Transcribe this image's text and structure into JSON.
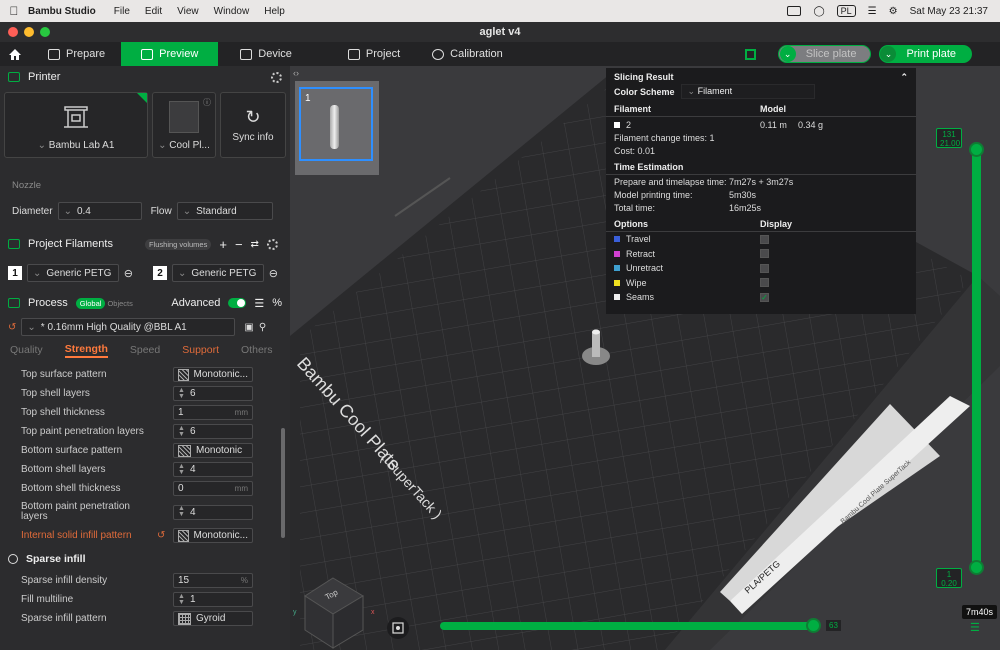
{
  "menubar": {
    "app_name": "Bambu Studio",
    "items": [
      "File",
      "Edit",
      "View",
      "Window",
      "Help"
    ],
    "input_badge": "PL",
    "datetime": "Sat May 23  21:37"
  },
  "window": {
    "title": "aglet v4"
  },
  "toolbar": {
    "tabs": [
      "Prepare",
      "Preview",
      "Device",
      "Project",
      "Calibration"
    ],
    "slice_label": "Slice plate",
    "print_label": "Print plate"
  },
  "printer": {
    "header": "Printer",
    "printer_name": "Bambu Lab A1",
    "plate_name": "Cool Pl...",
    "sync_label": "Sync info",
    "nozzle_label": "Nozzle",
    "diameter_label": "Diameter",
    "diameter_value": "0.4",
    "flow_label": "Flow",
    "flow_value": "Standard"
  },
  "filaments": {
    "header": "Project Filaments",
    "flushing_label": "Flushing volumes",
    "items": [
      {
        "num": "1",
        "name": "Generic PETG"
      },
      {
        "num": "2",
        "name": "Generic PETG"
      }
    ]
  },
  "process": {
    "header": "Process",
    "toggle_global": "Global",
    "toggle_objects": "Objects",
    "advanced_label": "Advanced",
    "preset": "* 0.16mm High Quality @BBL A1",
    "subtabs": [
      "Quality",
      "Strength",
      "Speed",
      "Support",
      "Others"
    ],
    "params": [
      {
        "label": "Top surface pattern",
        "value": "Monotonic...",
        "kind": "pattern"
      },
      {
        "label": "Top shell layers",
        "value": "6",
        "kind": "spin"
      },
      {
        "label": "Top shell thickness",
        "value": "1",
        "unit": "mm",
        "kind": "text"
      },
      {
        "label": "Top paint penetration layers",
        "value": "6",
        "kind": "spin"
      },
      {
        "label": "Bottom surface pattern",
        "value": "Monotonic",
        "kind": "pattern"
      },
      {
        "label": "Bottom shell layers",
        "value": "4",
        "kind": "spin"
      },
      {
        "label": "Bottom shell thickness",
        "value": "0",
        "unit": "mm",
        "kind": "text"
      },
      {
        "label": "Bottom paint penetration layers",
        "value": "4",
        "kind": "spin"
      },
      {
        "label": "Internal solid infill pattern",
        "value": "Monotonic...",
        "kind": "pattern"
      }
    ],
    "sparse_header": "Sparse infill",
    "sparse_params": [
      {
        "label": "Sparse infill density",
        "value": "15",
        "unit": "%"
      },
      {
        "label": "Fill multiline",
        "value": "1"
      },
      {
        "label": "Sparse infill pattern",
        "value": "Gyroid"
      }
    ]
  },
  "viewport": {
    "plate_thumb_num": "1",
    "bed_label": "Bambu Cool Plate",
    "bed_sublabel": "( SuperTack )",
    "edge_label": "Bambu Cool Plate SuperTack",
    "material_tag": "PLA/PETG",
    "view_cube_label": "Top",
    "layer_top": "131",
    "layer_top_height": "21.00",
    "layer_bottom": "1",
    "layer_bottom_height": "0.20",
    "move_value": "63",
    "total_time_badge": "7m40s"
  },
  "slicing_result": {
    "title": "Slicing Result",
    "color_scheme_label": "Color Scheme",
    "color_scheme_value": "Filament",
    "filament_header": "Filament",
    "model_header": "Model",
    "filament_num": "2",
    "filament_len": "0.11 m",
    "filament_weight": "0.34 g",
    "change_times": "Filament change times:  1",
    "cost": "Cost:  0.01",
    "time_header": "Time Estimation",
    "time_rows": [
      {
        "k": "Prepare and timelapse time:",
        "v": "7m27s + 3m27s"
      },
      {
        "k": "Model printing time:",
        "v": "5m30s"
      },
      {
        "k": "Total time:",
        "v": "16m25s"
      }
    ],
    "options_header": "Options",
    "display_header": "Display",
    "options": [
      {
        "name": "Travel",
        "color": "#3a5fd9",
        "checked": false
      },
      {
        "name": "Retract",
        "color": "#d040d0",
        "checked": false
      },
      {
        "name": "Unretract",
        "color": "#3fa0d0",
        "checked": false
      },
      {
        "name": "Wipe",
        "color": "#f0e020",
        "checked": false
      },
      {
        "name": "Seams",
        "color": "#eeeeee",
        "checked": true
      }
    ]
  },
  "colors": {
    "accent": "#00ae42",
    "strength_tab": "#ff7a3d"
  }
}
